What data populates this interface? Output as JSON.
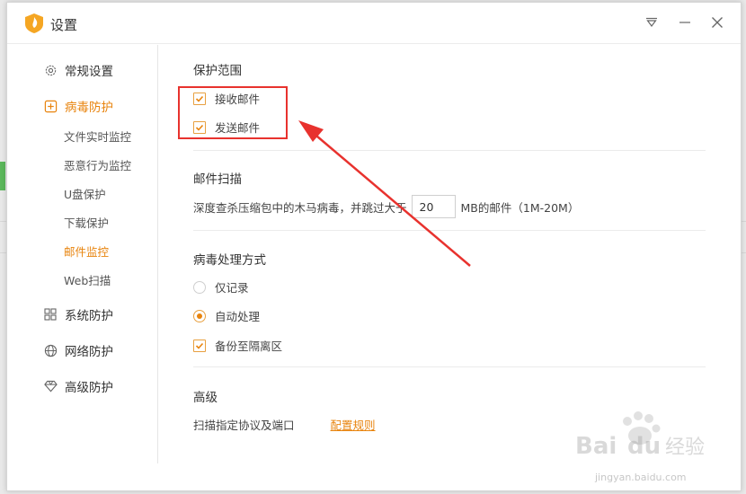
{
  "window": {
    "title": "设置"
  },
  "sidebar": {
    "categories": [
      {
        "label": "常规设置",
        "icon": "gear-icon"
      },
      {
        "label": "病毒防护",
        "icon": "plus-square-icon",
        "active": true
      },
      {
        "label": "系统防护",
        "icon": "grid-icon"
      },
      {
        "label": "网络防护",
        "icon": "globe-icon"
      },
      {
        "label": "高级防护",
        "icon": "diamond-icon"
      }
    ],
    "sub_items": [
      {
        "label": "文件实时监控"
      },
      {
        "label": "恶意行为监控"
      },
      {
        "label": "U盘保护"
      },
      {
        "label": "下载保护"
      },
      {
        "label": "邮件监控",
        "active": true
      },
      {
        "label": "Web扫描"
      }
    ]
  },
  "protection_scope": {
    "title": "保护范围",
    "receive_mail": {
      "label": "接收邮件",
      "checked": true
    },
    "send_mail": {
      "label": "发送邮件",
      "checked": true
    }
  },
  "mail_scan": {
    "title": "邮件扫描",
    "prefix": "深度查杀压缩包中的木马病毒，并跳过大于",
    "size_value": "20",
    "suffix": "MB的邮件（1M-20M）"
  },
  "virus_handling": {
    "title": "病毒处理方式",
    "record_only": {
      "label": "仅记录",
      "selected": false
    },
    "auto_process": {
      "label": "自动处理",
      "selected": true
    },
    "backup": {
      "label": "备份至隔离区",
      "checked": true
    }
  },
  "advanced": {
    "title": "高级",
    "scan_label": "扫描指定协议及端口",
    "config_link": "配置规则"
  },
  "watermark": {
    "text": "jingyan.baidu.com"
  },
  "colors": {
    "accent": "#e8840e",
    "annotation_red": "#e8322e"
  }
}
